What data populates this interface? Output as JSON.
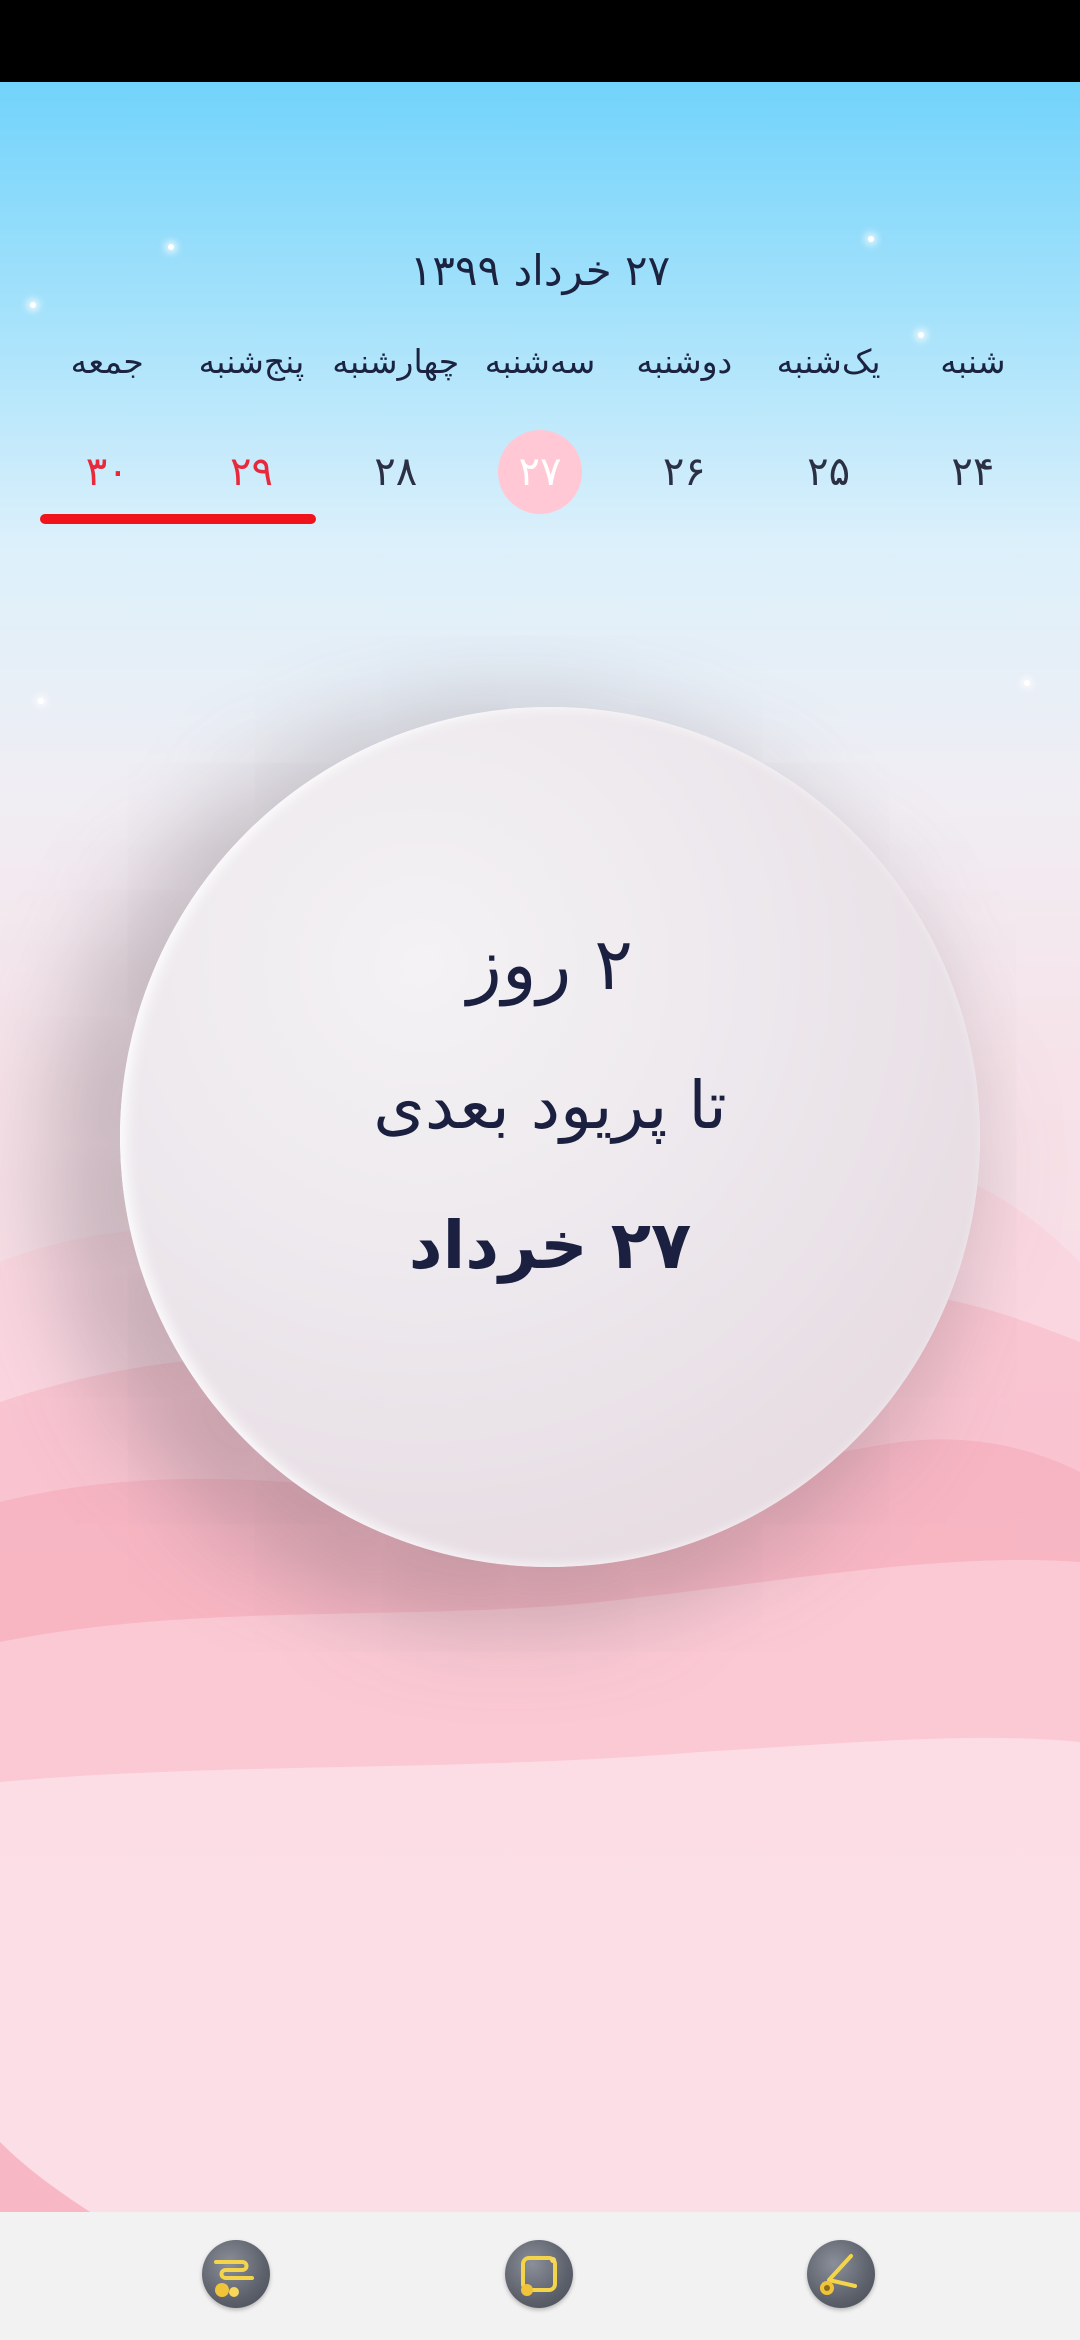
{
  "header": {
    "date_title": "۲۷ خرداد ۱۳۹۹"
  },
  "week": {
    "days": [
      {
        "name": "شنبه",
        "date": "۲۴",
        "state": "normal"
      },
      {
        "name": "یک‌شنبه",
        "date": "۲۵",
        "state": "normal"
      },
      {
        "name": "دوشنبه",
        "date": "۲۶",
        "state": "normal"
      },
      {
        "name": "سه‌شنبه",
        "date": "۲۷",
        "state": "today"
      },
      {
        "name": "چهارشنبه",
        "date": "۲۸",
        "state": "normal"
      },
      {
        "name": "پنج‌شنبه",
        "date": "۲۹",
        "state": "predicted-period"
      },
      {
        "name": "جمعه",
        "date": "۳۰",
        "state": "predicted-period"
      }
    ]
  },
  "countdown": {
    "days_line": "۲ روز",
    "label_line": "تا پریود بعدی",
    "date_line": "۲۷ خرداد"
  },
  "bottom_nav": {
    "items": [
      {
        "icon": "calendar-edit-icon"
      },
      {
        "icon": "notes-icon"
      },
      {
        "icon": "settings-wrench-icon"
      }
    ]
  },
  "colors": {
    "today_highlight": "#ffc8d4",
    "period_red": "#e8283b",
    "underline_red": "#f0131b",
    "text_dark": "#1b2040"
  }
}
